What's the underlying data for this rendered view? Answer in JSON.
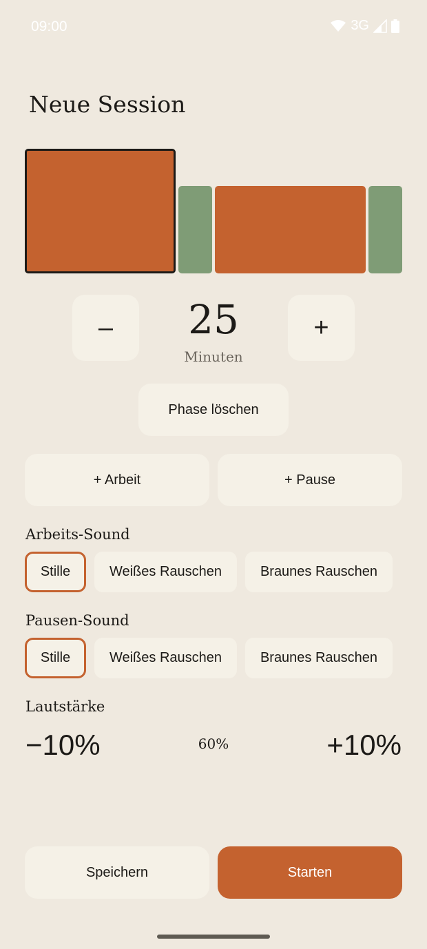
{
  "status_bar": {
    "time": "09:00",
    "network": "3G",
    "icons": [
      "wifi-icon",
      "signal-icon",
      "battery-icon"
    ]
  },
  "title": "Neue Session",
  "timeline": {
    "segments": [
      {
        "type": "work",
        "selected": true
      },
      {
        "type": "pause",
        "selected": false
      },
      {
        "type": "work",
        "selected": false
      },
      {
        "type": "pause",
        "selected": false
      }
    ]
  },
  "duration": {
    "minus_label": "–",
    "plus_label": "+",
    "value": "25",
    "unit": "Minuten"
  },
  "actions": {
    "delete_phase": "Phase löschen",
    "add_work": "+ Arbeit",
    "add_pause": "+ Pause"
  },
  "work_sound": {
    "label": "Arbeits-Sound",
    "options": [
      "Stille",
      "Weißes Rauschen",
      "Braunes Rauschen"
    ],
    "selected": "Stille"
  },
  "pause_sound": {
    "label": "Pausen-Sound",
    "options": [
      "Stille",
      "Weißes Rauschen",
      "Braunes Rauschen"
    ],
    "selected": "Stille"
  },
  "volume": {
    "label": "Lautstärke",
    "decrease": "−10%",
    "value": "60%",
    "increase": "+10%"
  },
  "footer": {
    "save": "Speichern",
    "start": "Starten"
  },
  "colors": {
    "background": "#efe9df",
    "work": "#c4622f",
    "pause": "#7f9c76",
    "tile": "#f5f1e7",
    "accent": "#c4622f"
  }
}
